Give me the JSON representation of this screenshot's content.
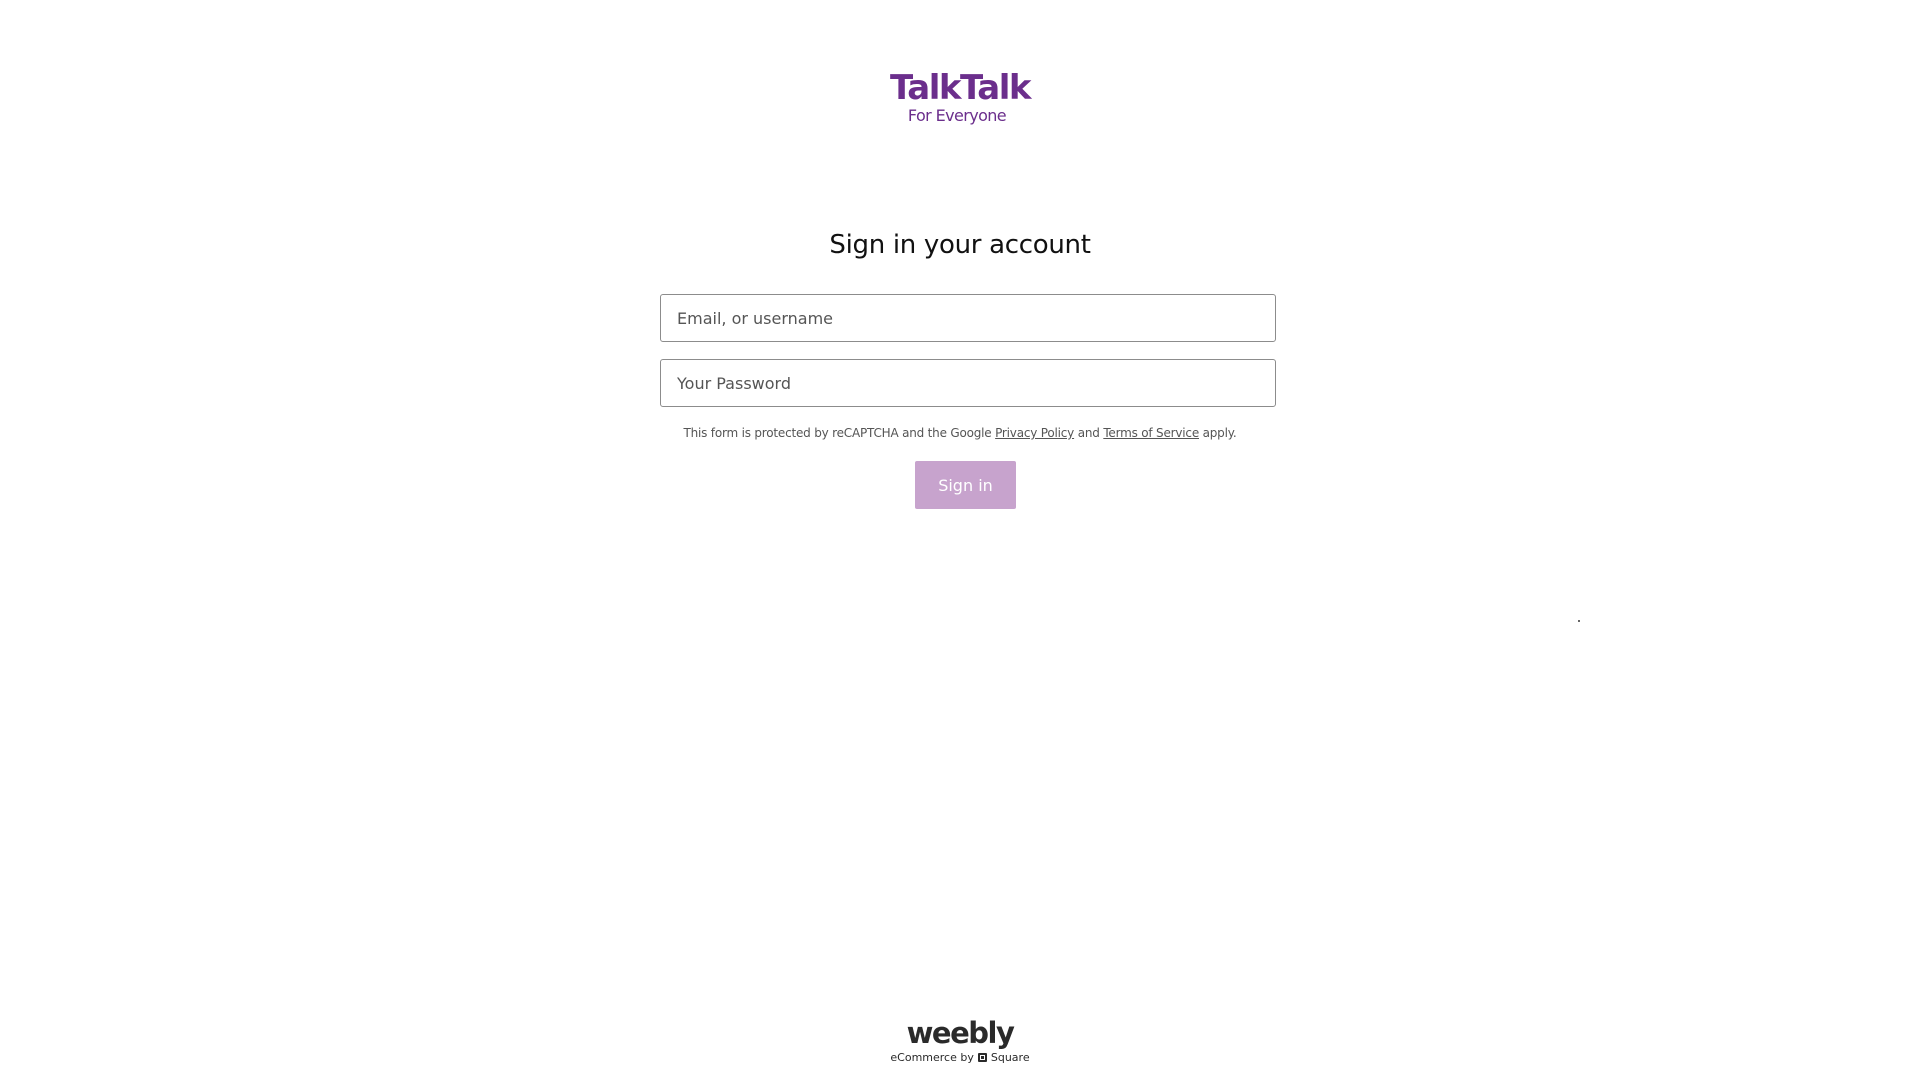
{
  "logo": {
    "wordmark": "TalkTalk",
    "tagline": "For Everyone"
  },
  "heading": "Sign in your account",
  "form": {
    "email_placeholder": "Email, or username",
    "password_placeholder": "Your Password",
    "notice_prefix": "This form is protected by reCAPTCHA and the Google ",
    "privacy_link": "Privacy Policy",
    "notice_and": " and ",
    "terms_link": "Terms of Service",
    "notice_suffix": " apply.",
    "signin_label": "Sign in"
  },
  "footer": {
    "wordmark": "weebly",
    "sub_prefix": "eCommerce by",
    "sub_brand": "Square"
  },
  "colors": {
    "brand": "#6b2e8c",
    "button": "#c7a3cd"
  }
}
